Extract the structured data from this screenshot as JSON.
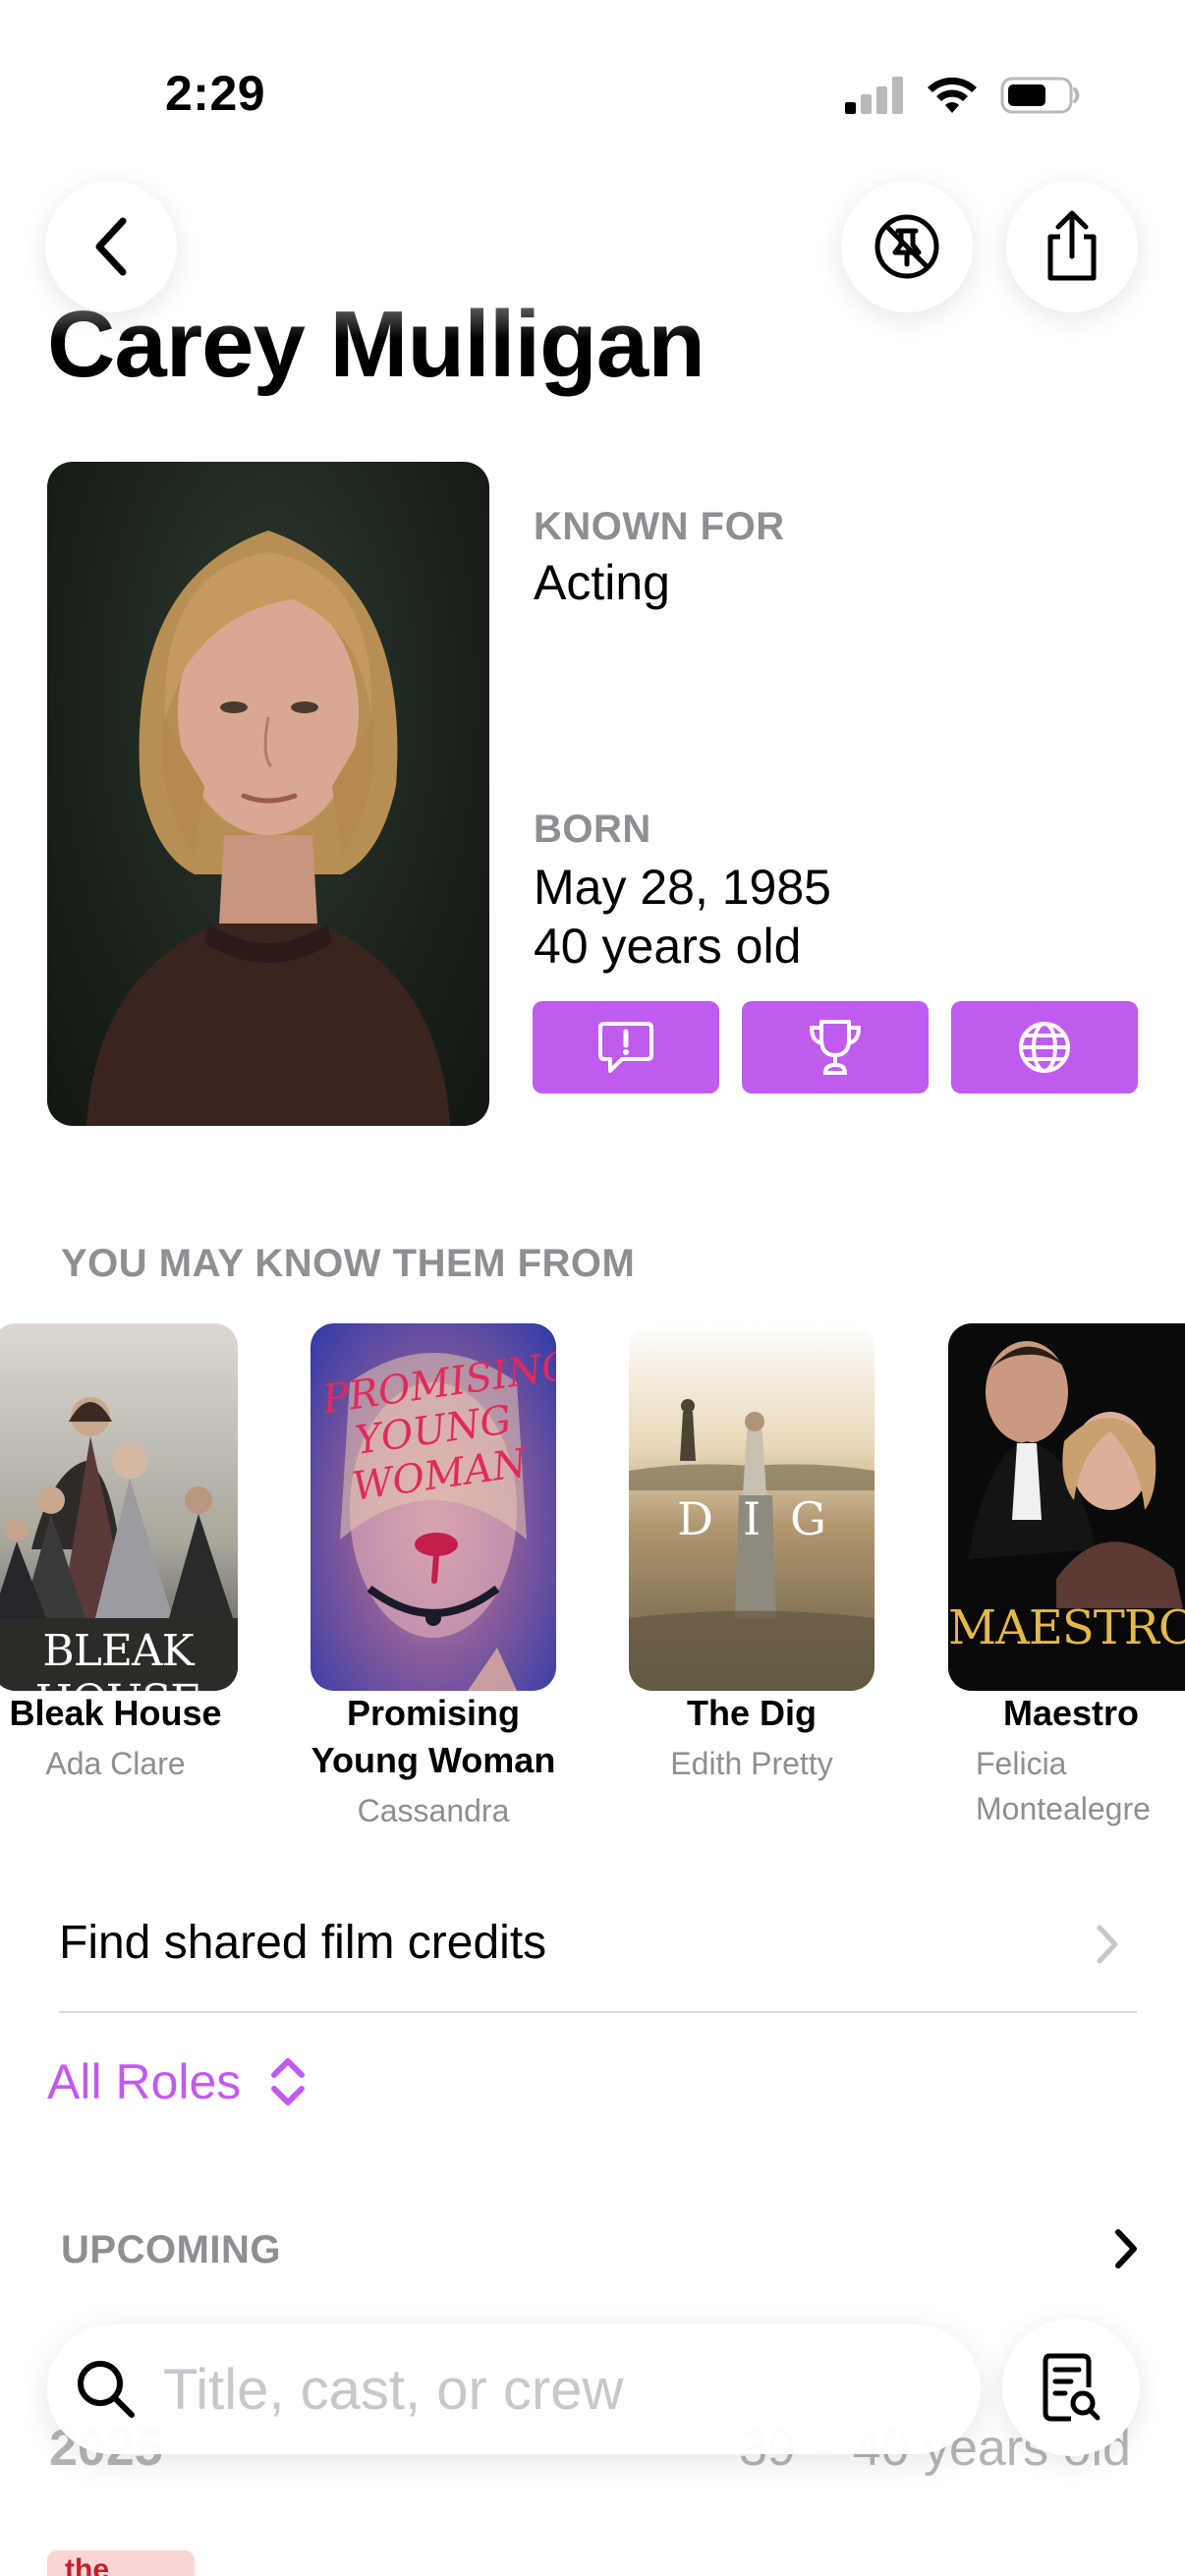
{
  "status_bar": {
    "time": "2:29"
  },
  "person": {
    "name": "Carey Mulligan",
    "known_for_label": "KNOWN FOR",
    "known_for_value": "Acting",
    "born_label": "BORN",
    "born_date": "May 28, 1985",
    "age": "40 years old"
  },
  "known_from": {
    "title": "YOU MAY KNOW THEM FROM",
    "items": [
      {
        "title": "Bleak House",
        "role": "Ada Clare",
        "poster_text": "BLEAK HOUSE"
      },
      {
        "title": "Promising Young Woman",
        "role": "Cassandra",
        "poster_text": "PROMISING YOUNG WOMAN"
      },
      {
        "title": "The Dig",
        "role": "Edith Pretty",
        "poster_text": "DIG"
      },
      {
        "title": "Maestro",
        "role": "Felicia Montealegre",
        "poster_text": "MAESTRO"
      }
    ]
  },
  "shared_credits": {
    "label": "Find shared film credits"
  },
  "roles_filter": {
    "label": "All Roles"
  },
  "upcoming": {
    "title": "UPCOMING",
    "year_partial": "2025",
    "age_partial": "39 – 40 years old",
    "badge_partial": "the"
  },
  "search": {
    "placeholder": "Title, cast, or crew"
  },
  "colors": {
    "accent": "#c05bf0",
    "secondary_text": "#8e8e93"
  }
}
